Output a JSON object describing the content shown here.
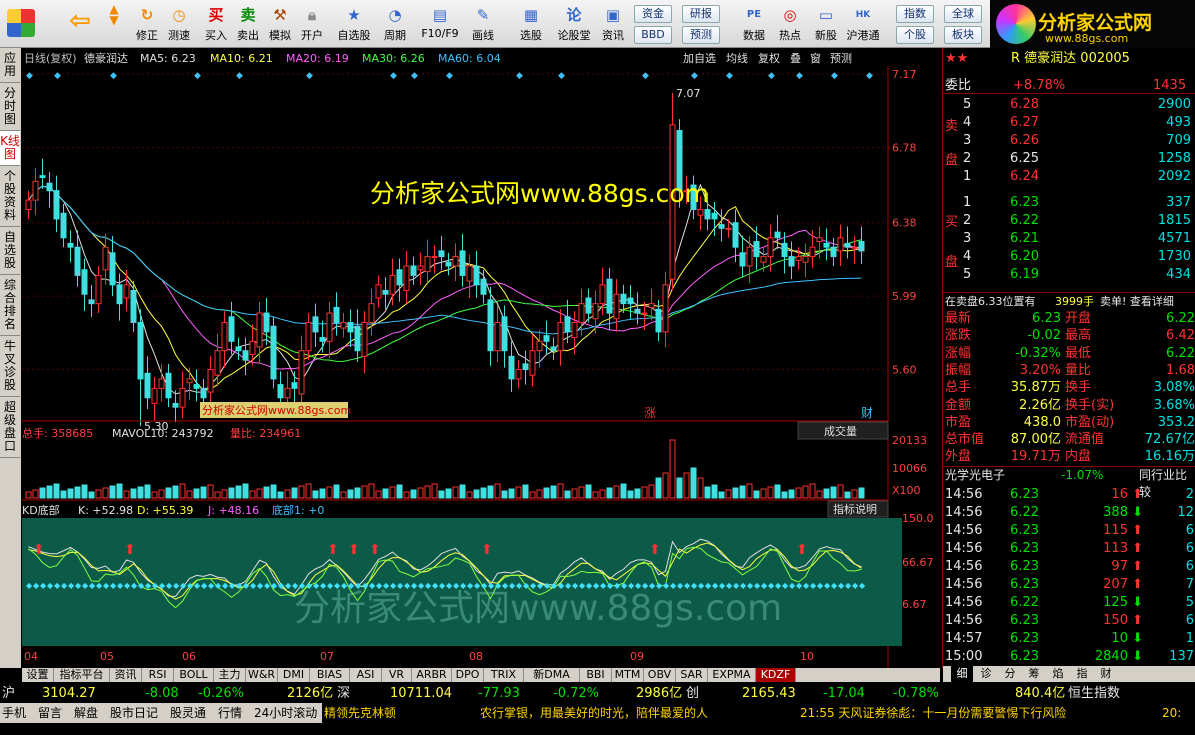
{
  "toolbar": {
    "buttons": [
      "修正",
      "测速",
      "买入",
      "卖出",
      "模拟",
      "开户",
      "自选股",
      "周期",
      "F10/F9",
      "画线",
      "选股",
      "论股堂",
      "资讯",
      "数据",
      "热点",
      "新股",
      "沪港通"
    ],
    "chips": [
      "资金",
      "研报",
      "BBD",
      "预测",
      "指数",
      "全球",
      "个股",
      "板块"
    ],
    "logo_text": "分析家公式网",
    "logo_url": "www.88gs.com"
  },
  "leftnav": [
    "应用",
    "分时图",
    "K线图",
    "个股资料",
    "自选股",
    "综合排名",
    "牛叉诊股",
    "超级盘口"
  ],
  "chart": {
    "header": {
      "name": "日线(复权)",
      "stock": "德豪润达",
      "ma5": "MA5: 6.23",
      "ma10": "MA10: 6.21",
      "ma20": "MA20: 6.19",
      "ma30": "MA30: 6.26",
      "ma60": "MA60: 6.04"
    },
    "header_btns": [
      "加自选",
      "均线",
      "复权",
      "叠",
      "窗",
      "预测"
    ],
    "price_axis": [
      "7.17",
      "6.78",
      "6.38",
      "5.99",
      "5.60"
    ],
    "high_label": "7.07",
    "low_label": "5.30",
    "zhang": "涨",
    "cai": "财",
    "watermark": "分析家公式网www.88gs.com",
    "watermark_small": "分析家公式网www.88gs.com",
    "vol_header": {
      "total": "总手: 358685",
      "mavol": "MAVOL10: 243792",
      "lb": "量比: 234961"
    },
    "vol_btn": "成交量",
    "vol_axis": [
      "20133",
      "10066",
      "X100"
    ],
    "kd_header": {
      "name": "KD底部",
      "k": "K: +52.98",
      "d": "D: +55.39",
      "j": "J: +48.16",
      "bottom": "底部1: +0"
    },
    "kd_btn": "指标说明",
    "kd_axis": [
      "150.0",
      "66.67",
      "6.67"
    ],
    "kd_watermark": "分析家公式网www.88gs.com",
    "months": [
      "04",
      "05",
      "06",
      "07",
      "08",
      "09",
      "10"
    ]
  },
  "chart_data": {
    "type": "candlestick",
    "title": "德豪润达 日线(复权)",
    "ylim": [
      5.3,
      7.17
    ],
    "ma": {
      "MA5": 6.23,
      "MA10": 6.21,
      "MA20": 6.19,
      "MA30": 6.26,
      "MA60": 6.04
    },
    "high": 7.07,
    "low": 5.3,
    "close": [
      6.5,
      6.6,
      6.62,
      6.55,
      6.4,
      6.3,
      6.25,
      6.1,
      6.0,
      5.95,
      6.1,
      6.25,
      6.05,
      5.95,
      6.05,
      5.85,
      5.55,
      5.45,
      5.5,
      5.55,
      5.45,
      5.4,
      5.5,
      5.55,
      5.5,
      5.45,
      5.6,
      5.7,
      5.85,
      5.75,
      5.7,
      5.65,
      5.75,
      5.9,
      5.8,
      5.55,
      5.45,
      5.5,
      5.5,
      5.7,
      5.85,
      5.8,
      5.75,
      5.9,
      5.85,
      5.85,
      5.8,
      5.7,
      5.85,
      5.95,
      6.05,
      6.0,
      6.1,
      6.05,
      6.15,
      6.1,
      6.15,
      6.2,
      6.2,
      6.2,
      6.15,
      6.2,
      6.1,
      6.15,
      6.05,
      6.0,
      5.7,
      5.85,
      5.7,
      5.55,
      5.6,
      5.6,
      5.7,
      5.75,
      5.75,
      5.7,
      5.85,
      5.8,
      5.85,
      5.95,
      5.9,
      5.95,
      6.05,
      5.9,
      6.0,
      5.95,
      5.95,
      5.9,
      5.9,
      5.95,
      5.8,
      6.05,
      6.9,
      6.55,
      6.55,
      6.45,
      6.45,
      6.4,
      6.4,
      6.35,
      6.35,
      6.25,
      6.15,
      6.25,
      6.2,
      6.2,
      6.3,
      6.3,
      6.2,
      6.15,
      6.2,
      6.2,
      6.25,
      6.3,
      6.25,
      6.2,
      6.3,
      6.25,
      6.25,
      6.23
    ],
    "vol_last": 358685
  },
  "quote": {
    "code_title": "R 德豪润达 002005",
    "weibi": "委比",
    "weibi_pct": "+8.78%",
    "weibi_val": "1435",
    "asks": [
      {
        "l": "5",
        "p": "6.28",
        "v": "2900"
      },
      {
        "l": "4",
        "p": "6.27",
        "v": "493"
      },
      {
        "l": "3",
        "p": "6.26",
        "v": "709"
      },
      {
        "l": "2",
        "p": "6.25",
        "v": "1258"
      },
      {
        "l": "1",
        "p": "6.24",
        "v": "2092"
      }
    ],
    "bids": [
      {
        "l": "1",
        "p": "6.23",
        "v": "337"
      },
      {
        "l": "2",
        "p": "6.22",
        "v": "1815"
      },
      {
        "l": "3",
        "p": "6.21",
        "v": "4571"
      },
      {
        "l": "4",
        "p": "6.20",
        "v": "1730"
      },
      {
        "l": "5",
        "p": "6.19",
        "v": "434"
      }
    ],
    "sell_label": "卖盘",
    "buy_label": "买盘",
    "info_line": "在卖盘6.33位置有",
    "info_vol": "3999手",
    "info_tail": "卖单! 查看详细",
    "stats": [
      [
        "最新",
        "6.23",
        "开盘",
        "6.22"
      ],
      [
        "涨跌",
        "-0.02",
        "最高",
        "6.42"
      ],
      [
        "涨幅",
        "-0.32%",
        "最低",
        "6.22"
      ],
      [
        "振幅",
        "3.20%",
        "量比",
        "1.68"
      ],
      [
        "总手",
        "35.87万",
        "换手",
        "3.08%"
      ],
      [
        "金额",
        "2.26亿",
        "换手(实)",
        "3.68%"
      ],
      [
        "市盈",
        "438.0",
        "市盈(动)",
        "353.2"
      ],
      [
        "总市值",
        "87.00亿",
        "流通值",
        "72.67亿"
      ],
      [
        "外盘",
        "19.71万",
        "内盘",
        "16.16万"
      ]
    ],
    "industry": "光学光电子",
    "industry_pct": "-1.07%",
    "industry_btn": "同行业比较",
    "ticks": [
      [
        "14:56",
        "6.23",
        "16",
        "2"
      ],
      [
        "14:56",
        "6.22",
        "388",
        "12"
      ],
      [
        "14:56",
        "6.23",
        "115",
        "6"
      ],
      [
        "14:56",
        "6.23",
        "113",
        "6"
      ],
      [
        "14:56",
        "6.23",
        "97",
        "6"
      ],
      [
        "14:56",
        "6.23",
        "207",
        "7"
      ],
      [
        "14:56",
        "6.22",
        "125",
        "5"
      ],
      [
        "14:56",
        "6.23",
        "150",
        "6"
      ],
      [
        "14:57",
        "6.23",
        "10",
        "1"
      ],
      [
        "15:00",
        "6.23",
        "2840",
        "137"
      ]
    ],
    "rtabs": [
      "细",
      "诊",
      "分",
      "筹",
      "焰",
      "指",
      "财"
    ]
  },
  "bottom_tabs": [
    "设置",
    "指标平台",
    "资讯",
    "RSI",
    "BOLL",
    "主力",
    "W&R",
    "DMI",
    "BIAS",
    "ASI",
    "VR",
    "ARBR",
    "DPO",
    "TRIX",
    "新DMA",
    "BBI",
    "MTM",
    "OBV",
    "SAR",
    "EXPMA",
    "KDZF"
  ],
  "index_bar": {
    "sh": "沪",
    "sh_val": "3104.27",
    "sh_chg": "-8.08",
    "sh_pct": "-0.26%",
    "sh_amt": "2126亿",
    "sz": "深",
    "sz_val": "10711.04",
    "sz_chg": "-77.93",
    "sz_pct": "-0.72%",
    "sz_amt": "2986亿",
    "cy": "创",
    "cy_val": "2165.43",
    "cy_chg": "-17.04",
    "cy_pct": "-0.78%",
    "cy_amt": "840.4亿",
    "hs": "恒生指数"
  },
  "status": {
    "items": [
      "手机",
      "留言",
      "解盘",
      "股市日记",
      "股灵通",
      "行情",
      "24小时滚动"
    ],
    "news1": "精领先克林顿",
    "news2": "农行掌银，用最美好的时光，陪伴最爱的人",
    "news3": "21:55 天风证券徐彪：十一月份需要警惕下行风险",
    "clock": "20:"
  }
}
